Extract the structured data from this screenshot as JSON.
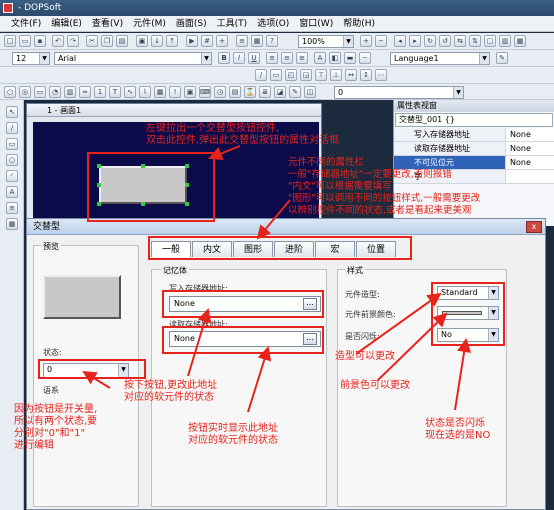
{
  "app": {
    "title": "- DOPSoft"
  },
  "menu": [
    "文件(F)",
    "编辑(E)",
    "查看(V)",
    "元件(M)",
    "画面(S)",
    "工具(T)",
    "选项(O)",
    "窗口(W)",
    "帮助(H)"
  ],
  "toolbar": {
    "zoom": "100%",
    "font_size": "12",
    "font_name": "Arial",
    "language": "Language1",
    "state_combo": "0"
  },
  "screen": {
    "title": "1 - 画面1"
  },
  "properties": {
    "header": "属性表视窗",
    "selected": "交替型_001 {}",
    "rows": [
      {
        "key": "写入存储器地址",
        "value": "None"
      },
      {
        "key": "读取存储器地址",
        "value": "None"
      },
      {
        "key": "不可见位元",
        "value": "None"
      }
    ],
    "partial_row": "字"
  },
  "dialog": {
    "title": "交替型",
    "close": "x",
    "tabs": [
      "一般",
      "内文",
      "图形",
      "进阶",
      "宏",
      "位置"
    ],
    "preview_label": "预览",
    "state_label": "状态:",
    "state_value": "0",
    "lang_label": "语系",
    "memory_group": "记忆体",
    "write_label": "写入存储器地址:",
    "write_value": "None",
    "read_label": "读取存储器地址:",
    "read_value": "None",
    "dots": "...",
    "style_group": "样式",
    "style_label": "元件造型:",
    "style_value": "Standard",
    "fg_label": "元件前景颜色:",
    "blink_label": "是否闪烁:",
    "blink_value": "No"
  },
  "annotations": {
    "a1": [
      "左键拉出一个交替型按钮控件,",
      "双击此控件,弹出此交替型按钮的属性对话框"
    ],
    "a2": [
      "元件不同的属性栏",
      "一般\"存储器地址\"一定要更改,否则报错",
      "\"内文\"可以根据需要填写",
      "\"图形\"可以调用不同的按钮样式,一般需要更改",
      "以辨别控件不同的状态,或者是看起来更美观"
    ],
    "a3": [
      "按下按钮,更改此地址",
      "对应的软元件的状态"
    ],
    "a4": [
      "按钮实时显示此地址",
      "对应的软元件的状态"
    ],
    "a5": [
      "造型可以更改"
    ],
    "a6": [
      "前景色可以更改"
    ],
    "a7": [
      "状态是否闪烁",
      "现在选的是NO"
    ],
    "a8": [
      "因为按钮是开关量,",
      "所以有两个状态,要",
      "分别对\"0\"和\"1\"",
      "进行编辑"
    ]
  },
  "colors": {
    "annotation": "#e8231b",
    "canvas": "#0b0b4a"
  }
}
